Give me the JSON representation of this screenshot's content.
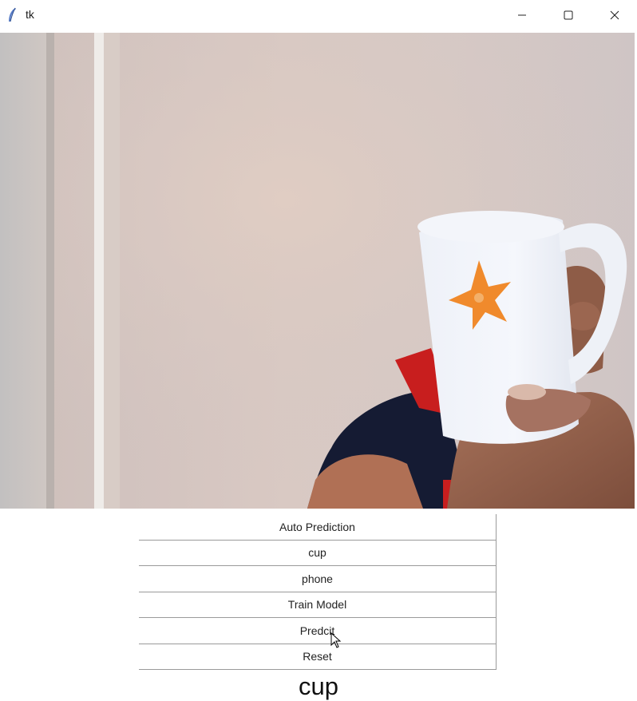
{
  "window": {
    "title": "tk",
    "controls": [
      "minimize-icon",
      "maximize-icon",
      "close-icon"
    ]
  },
  "video_feed": {
    "description_icon": "camera-frame"
  },
  "buttons": [
    {
      "label": "Auto Prediction"
    },
    {
      "label": "cup"
    },
    {
      "label": "phone"
    },
    {
      "label": "Train Model"
    },
    {
      "label": "Predcit"
    },
    {
      "label": "Reset"
    }
  ],
  "result": {
    "label": "cup"
  }
}
